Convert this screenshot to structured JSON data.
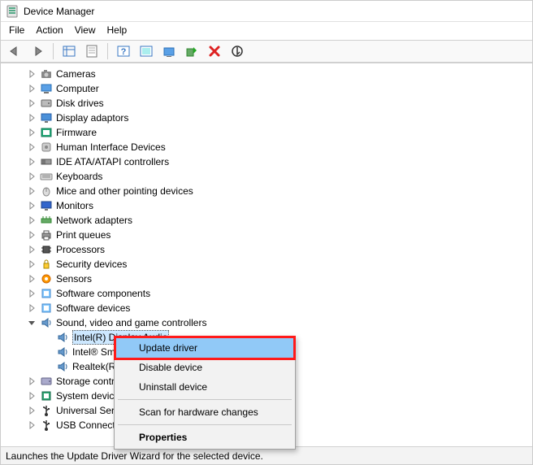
{
  "window": {
    "title": "Device Manager"
  },
  "menubar": {
    "items": [
      "File",
      "Action",
      "View",
      "Help"
    ]
  },
  "toolbar": {
    "buttons": [
      {
        "name": "back-icon"
      },
      {
        "name": "forward-icon"
      },
      {
        "name": "show-hidden-icon"
      },
      {
        "name": "properties-icon"
      },
      {
        "name": "help-icon"
      },
      {
        "name": "scan-hardware-icon"
      },
      {
        "name": "update-driver-icon"
      },
      {
        "name": "enable-device-icon"
      },
      {
        "name": "uninstall-icon"
      },
      {
        "name": "disable-device-icon"
      }
    ]
  },
  "tree": {
    "categories": [
      {
        "label": "Cameras",
        "icon": "camera"
      },
      {
        "label": "Computer",
        "icon": "computer"
      },
      {
        "label": "Disk drives",
        "icon": "disk"
      },
      {
        "label": "Display adaptors",
        "icon": "display"
      },
      {
        "label": "Firmware",
        "icon": "firmware"
      },
      {
        "label": "Human Interface Devices",
        "icon": "hid"
      },
      {
        "label": "IDE ATA/ATAPI controllers",
        "icon": "ide"
      },
      {
        "label": "Keyboards",
        "icon": "keyboard"
      },
      {
        "label": "Mice and other pointing devices",
        "icon": "mouse"
      },
      {
        "label": "Monitors",
        "icon": "monitor"
      },
      {
        "label": "Network adapters",
        "icon": "network"
      },
      {
        "label": "Print queues",
        "icon": "printer"
      },
      {
        "label": "Processors",
        "icon": "cpu"
      },
      {
        "label": "Security devices",
        "icon": "security"
      },
      {
        "label": "Sensors",
        "icon": "sensor"
      },
      {
        "label": "Software components",
        "icon": "software"
      },
      {
        "label": "Software devices",
        "icon": "software"
      }
    ],
    "expanded": {
      "label": "Sound, video and game controllers",
      "icon": "sound",
      "children": [
        {
          "label": "Intel(R) Display Audio",
          "selected": true
        },
        {
          "label": "Intel® Sm"
        },
        {
          "label": "Realtek(R)"
        }
      ]
    },
    "after": [
      {
        "label": "Storage contr",
        "icon": "storage"
      },
      {
        "label": "System device",
        "icon": "system"
      },
      {
        "label": "Universal Seri",
        "icon": "usb"
      },
      {
        "label": "USB Connecto",
        "icon": "usb"
      }
    ]
  },
  "contextMenu": {
    "items": [
      {
        "label": "Update driver",
        "highlighted": true
      },
      {
        "label": "Disable device"
      },
      {
        "label": "Uninstall device"
      },
      {
        "sep": true
      },
      {
        "label": "Scan for hardware changes"
      },
      {
        "sep": true
      },
      {
        "label": "Properties",
        "bold": true
      }
    ]
  },
  "statusbar": {
    "text": "Launches the Update Driver Wizard for the selected device."
  }
}
